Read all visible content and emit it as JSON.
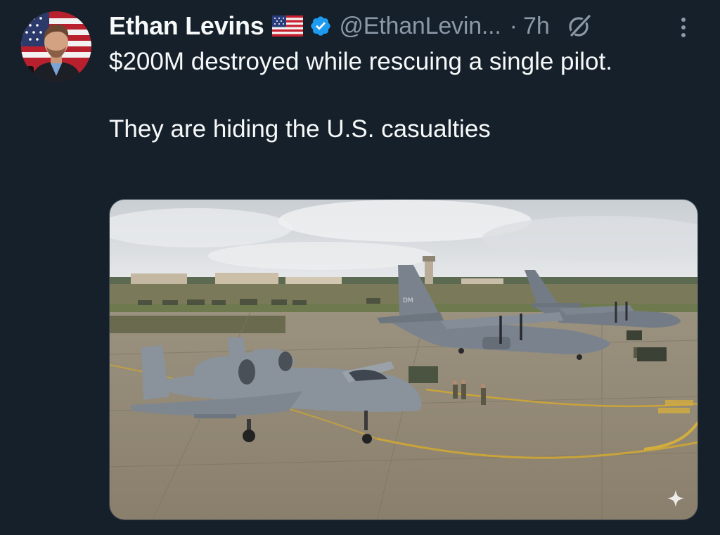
{
  "tweet": {
    "author": {
      "display_name": "Ethan Levins",
      "handle": "@EthanLevin...",
      "flag": "us-flag-emoji",
      "verified": true
    },
    "separator": "·",
    "timestamp": "7h",
    "text_lines": [
      "$200M destroyed while rescuing a single pilot.",
      "They are hiding the U.S. casualties"
    ],
    "media": {
      "type": "photo",
      "alt_icon": "sparkle-icon"
    }
  },
  "icons": {
    "verified": "verified-badge-icon",
    "grok": "grok-icon",
    "more": "more-options-icon"
  },
  "colors": {
    "background": "#15202b",
    "primary_text": "#f7f9f9",
    "secondary_text": "#8b98a5",
    "verified_blue": "#1d9bf0",
    "border": "#38444d"
  }
}
